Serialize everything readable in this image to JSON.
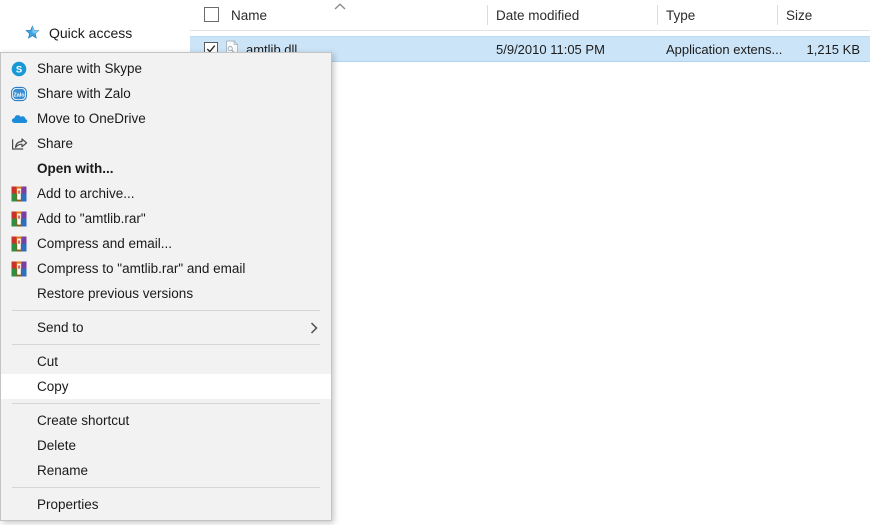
{
  "nav_pane": {
    "quick_access": {
      "label": "Quick access",
      "icon": "pin-star-icon"
    }
  },
  "file_list": {
    "columns": [
      {
        "key": "name",
        "label": "Name",
        "sorted": true,
        "sort_direction": "ascending"
      },
      {
        "key": "date",
        "label": "Date modified"
      },
      {
        "key": "type",
        "label": "Type"
      },
      {
        "key": "size",
        "label": "Size"
      }
    ],
    "select_all_checked": false,
    "rows": [
      {
        "checked": true,
        "selected": true,
        "name": "amtlib.dll",
        "date_modified": "5/9/2010 11:05 PM",
        "type": "Application extens...",
        "size": "1,215 KB",
        "icon": "dll-file-icon"
      }
    ]
  },
  "context_menu": {
    "highlighted_item": "Copy",
    "items": [
      {
        "label": "Share with Skype",
        "icon": "skype-icon"
      },
      {
        "label": "Share with Zalo",
        "icon": "zalo-icon"
      },
      {
        "label": "Move to OneDrive",
        "icon": "onedrive-cloud-icon"
      },
      {
        "label": "Share",
        "icon": "share-arrow-icon"
      },
      {
        "label": "Open with...",
        "icon": "none",
        "bold": true
      },
      {
        "label": "Add to archive...",
        "icon": "winrar-icon"
      },
      {
        "label": "Add to \"amtlib.rar\"",
        "icon": "winrar-icon"
      },
      {
        "label": "Compress and email...",
        "icon": "winrar-icon"
      },
      {
        "label": "Compress to \"amtlib.rar\" and email",
        "icon": "winrar-icon"
      },
      {
        "label": "Restore previous versions",
        "icon": "none"
      },
      {
        "separator": true
      },
      {
        "label": "Send to",
        "icon": "none",
        "submenu": true
      },
      {
        "separator": true
      },
      {
        "label": "Cut",
        "icon": "none"
      },
      {
        "label": "Copy",
        "icon": "none",
        "highlighted": true
      },
      {
        "separator": true
      },
      {
        "label": "Create shortcut",
        "icon": "none"
      },
      {
        "label": "Delete",
        "icon": "none"
      },
      {
        "label": "Rename",
        "icon": "none"
      },
      {
        "separator": true
      },
      {
        "label": "Properties",
        "icon": "none"
      }
    ]
  },
  "colors": {
    "selection_blue": "#cce4f7",
    "menu_background": "#f2f2f2",
    "menu_hover": "#ffffff",
    "accent_blue": "#0078d7"
  }
}
